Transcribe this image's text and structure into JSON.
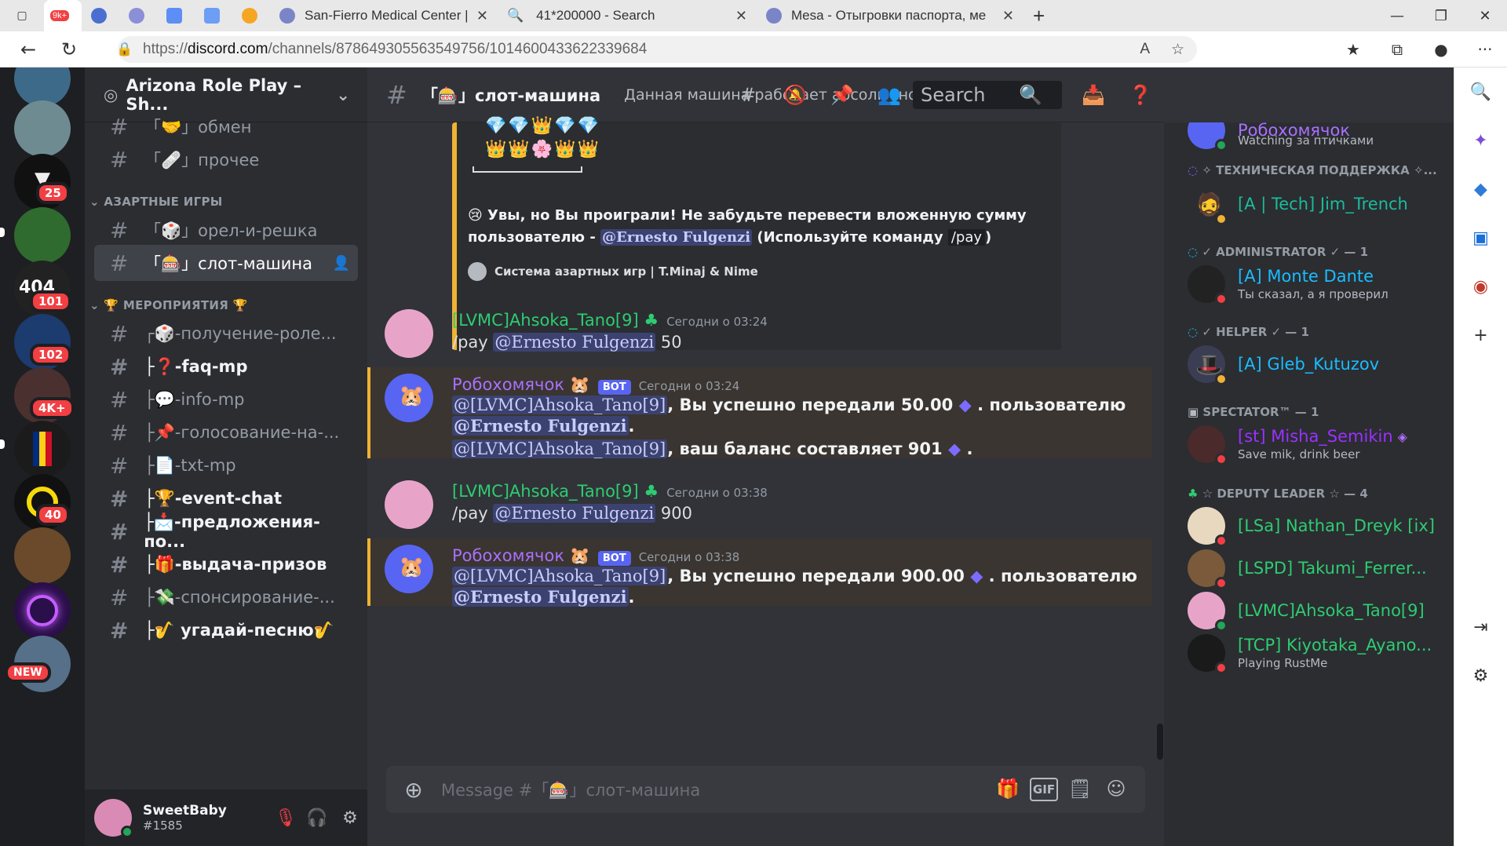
{
  "browser": {
    "tabs": [
      {
        "label": "9k+",
        "kind": "icon"
      },
      {
        "label": "San-Fierro Medical Center | ((Бин",
        "kind": "page"
      },
      {
        "label": "41*200000 - Search",
        "kind": "page"
      },
      {
        "label": "Mesa - Отыгровки паспорта, ме",
        "kind": "page"
      }
    ],
    "url_prefix": "https://",
    "url_host": "discord.com",
    "url_path": "/channels/878649305563549756/1014600433622339684",
    "new_tab": "+",
    "read_aloud": "A",
    "tools": [
      "star-plus",
      "favorites",
      "collections",
      "profile",
      "more"
    ],
    "more_label": "···"
  },
  "servers": [
    {
      "name": "server-1",
      "badge": ""
    },
    {
      "name": "server-2",
      "badge": ""
    },
    {
      "name": "server-3",
      "badge": "25"
    },
    {
      "name": "server-4",
      "badge": ""
    },
    {
      "name": "server-5",
      "badge": "101"
    },
    {
      "name": "server-6",
      "badge": "102"
    },
    {
      "name": "server-7",
      "badge": "4K+"
    },
    {
      "name": "server-8",
      "badge": ""
    },
    {
      "name": "server-9",
      "badge": "40"
    },
    {
      "name": "server-10",
      "badge": ""
    },
    {
      "name": "server-11",
      "badge": ""
    },
    {
      "name": "server-12",
      "badge": "NEW"
    }
  ],
  "guild": {
    "name": "Arizona Role Play – Sh...",
    "chevron": "⌄"
  },
  "categories": {
    "gambling": "АЗАРТНЫЕ ИГРЫ",
    "events": "🏆 МЕРОПРИЯТИЯ 🏆"
  },
  "channels": [
    {
      "label": "「🤝」обмен"
    },
    {
      "label": "「🩹」прочее"
    },
    {
      "label": "「🎲」орел-и-решка"
    },
    {
      "label": "「🎰」слот-машина"
    },
    {
      "label": "┌🎲-получение-роле..."
    },
    {
      "label": "├❓-faq-mp"
    },
    {
      "label": "├💬-info-mp"
    },
    {
      "label": "├📌-голосование-на-..."
    },
    {
      "label": "├📄-txt-mp"
    },
    {
      "label": "├🏆-event-chat"
    },
    {
      "label": "├📩-предложения-по..."
    },
    {
      "label": "├🎁-выдача-призов"
    },
    {
      "label": "├💸-спонсирование-..."
    },
    {
      "label": "├🎷 угадай-песню🎷"
    }
  ],
  "user": {
    "name": "SweetBaby",
    "tag": "#1585"
  },
  "header": {
    "channel": "「🎰」слот-машина",
    "topic": "Данная машина работает абсолютно не пр...",
    "search_placeholder": "Search"
  },
  "embed": {
    "slots_row1": "💎💎👑💎💎",
    "slots_row2": "👑👑🌸👑👑",
    "lose_text": "😢 Увы, но Вы проиграли! Не забудьте перевести вложенную сумму",
    "lose_text2_pre": "пользователю - ",
    "lose_mention": "@Ernesto Fulgenzi",
    "lose_text2_post": " (Используйте команду ",
    "lose_cmd": "/pay",
    "lose_close": ")",
    "footer": "Система азартных игр | T.Minaj & Nime"
  },
  "messages": [
    {
      "author": "[LVMC]Ahsoka_Tano[9]",
      "time": "Сегодни о 03:24",
      "cmd": "/pay",
      "mention": "@Ernesto Fulgenzi",
      "amount": "50"
    },
    {
      "author": "Робохомячок",
      "bot": "BOT",
      "time": "Сегодни о 03:24",
      "m1": "@[LVMC]Ahsoka_Tano[9]",
      "t1": ", Вы успешно передали 50.00",
      "t1b": ". пользователю",
      "m2": "@Ernesto Fulgenzi",
      "t2": ".",
      "m3": "@[LVMC]Ahsoka_Tano[9]",
      "t3": ", ваш баланс составляет 901",
      "t3b": "."
    },
    {
      "author": "[LVMC]Ahsoka_Tano[9]",
      "time": "Сегодни о 03:38",
      "cmd": "/pay",
      "mention": "@Ernesto Fulgenzi",
      "amount": "900"
    },
    {
      "author": "Робохомячок",
      "bot": "BOT",
      "time": "Сегодни о 03:38",
      "m1": "@[LVMC]Ahsoka_Tano[9]",
      "t1": ", Вы успешно передали 900.00",
      "t1b": ". пользователю",
      "m2": "@Ernesto Fulgenzi",
      "t2": "."
    }
  ],
  "composer": {
    "placeholder": "Message #「🎰」слот-машина",
    "gif": "GIF"
  },
  "members": {
    "top": {
      "name": "Робохомячок",
      "status": "Watching за птичками"
    },
    "roles": [
      {
        "label": "✧ ТЕХНИЧЕСКАЯ ПОДДЕРЖКА ✧..."
      },
      {
        "label": "✓ ADMINISTRATOR ✓ — 1"
      },
      {
        "label": "✓ HELPER ✓ — 1"
      },
      {
        "label": "SPECTATOR™ — 1"
      },
      {
        "label": "☆ DEPUTY LEADER ☆ — 4"
      }
    ],
    "list": [
      {
        "name": "[A | Tech] Jim_Trench",
        "status": ""
      },
      {
        "name": "[A] Monte Dante",
        "status": "Ты сказал, а я проверил"
      },
      {
        "name": "[A] Gleb_Kutuzov",
        "status": ""
      },
      {
        "name": "[st] Misha_Semikin",
        "status": "Save mik, drink beer"
      },
      {
        "name": "[LSa] Nathan_Dreyk [ix]",
        "status": ""
      },
      {
        "name": "[LSPD] Takumi_Ferrer...",
        "status": ""
      },
      {
        "name": "[LVMC]Ahsoka_Tano[9]",
        "status": ""
      },
      {
        "name": "[TCP] Kiyotaka_Ayano...",
        "status": "Playing RustMe"
      }
    ]
  },
  "colors": {
    "accent": "#5865f2",
    "highlight": "#f0b232",
    "online": "#23a55a",
    "dnd": "#f23f43",
    "idle": "#f0b232",
    "green_role": "#2ecc71",
    "teal_role": "#1abc9c"
  }
}
